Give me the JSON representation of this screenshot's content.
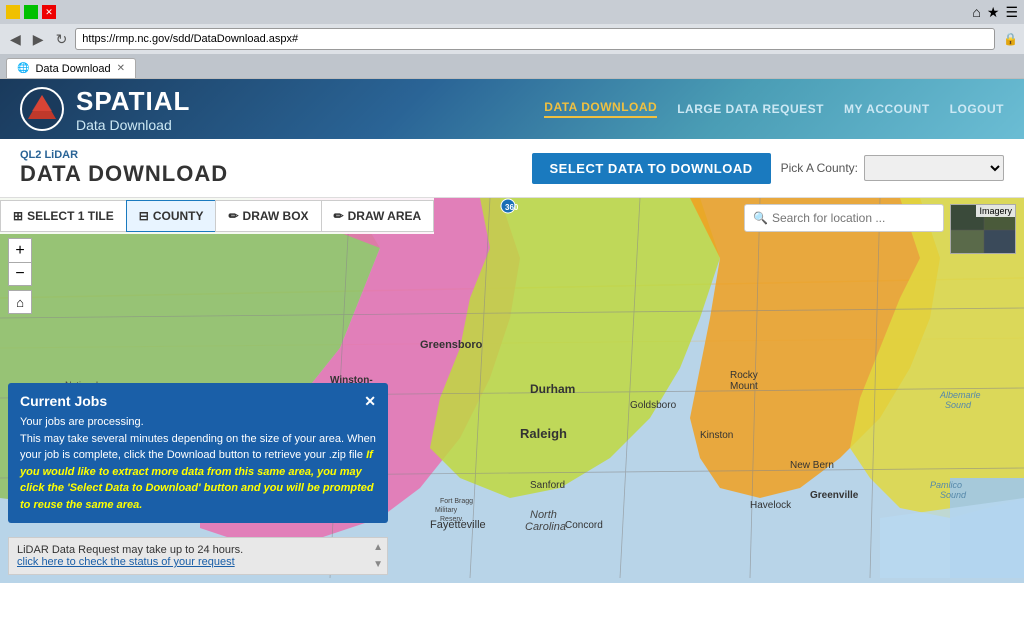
{
  "browser": {
    "url": "https://rmp.nc.gov/sdd/DataDownload.aspx#",
    "tab_title": "Data Download",
    "back_btn": "◀",
    "forward_btn": "▶",
    "refresh_btn": "↻",
    "home_icon": "⌂",
    "star_icon": "★",
    "menu_icon": "☰"
  },
  "header": {
    "logo_emblem": "🔺",
    "logo_title": "SPATIAL",
    "logo_subtitle": "Data Download",
    "nav": [
      {
        "label": "DATA DOWNLOAD",
        "active": true
      },
      {
        "label": "LARGE DATA REQUEST",
        "active": false
      },
      {
        "label": "MY ACCOUNT",
        "active": false
      },
      {
        "label": "LOGOUT",
        "active": false
      }
    ]
  },
  "page": {
    "subtitle": "QL2 LiDAR",
    "title": "DATA DOWNLOAD",
    "select_btn": "SELECT DATA TO DOWNLOAD",
    "county_label": "Pick A County:",
    "county_placeholder": ""
  },
  "map_toolbar": {
    "tools": [
      {
        "label": "SELECT 1 TILE",
        "icon": "⊞"
      },
      {
        "label": "COUNTY",
        "icon": "⊟"
      },
      {
        "label": "DRAW BOX",
        "icon": "✏"
      },
      {
        "label": "DRAW AREA",
        "icon": "✏"
      }
    ]
  },
  "map": {
    "search_placeholder": "Search for location ...",
    "imagery_label": "Imagery",
    "zoom_in": "+",
    "zoom_out": "−",
    "home": "⌂"
  },
  "jobs_panel": {
    "title": "Current Jobs",
    "close": "✕",
    "body_text": "Your jobs are processing.",
    "body_detail": "This may take several minutes depending on the size of your area. When your job is complete, click the Download button to retrieve your .zip file ",
    "highlight_text": "If you would like to extract more data from this same area, you may click the 'Select Data to Download' button and you will be prompted to reuse the same area.",
    "message_line1": "LiDAR Data Request may take up to 24 hours.",
    "message_link": "click here to check the status of your request"
  }
}
